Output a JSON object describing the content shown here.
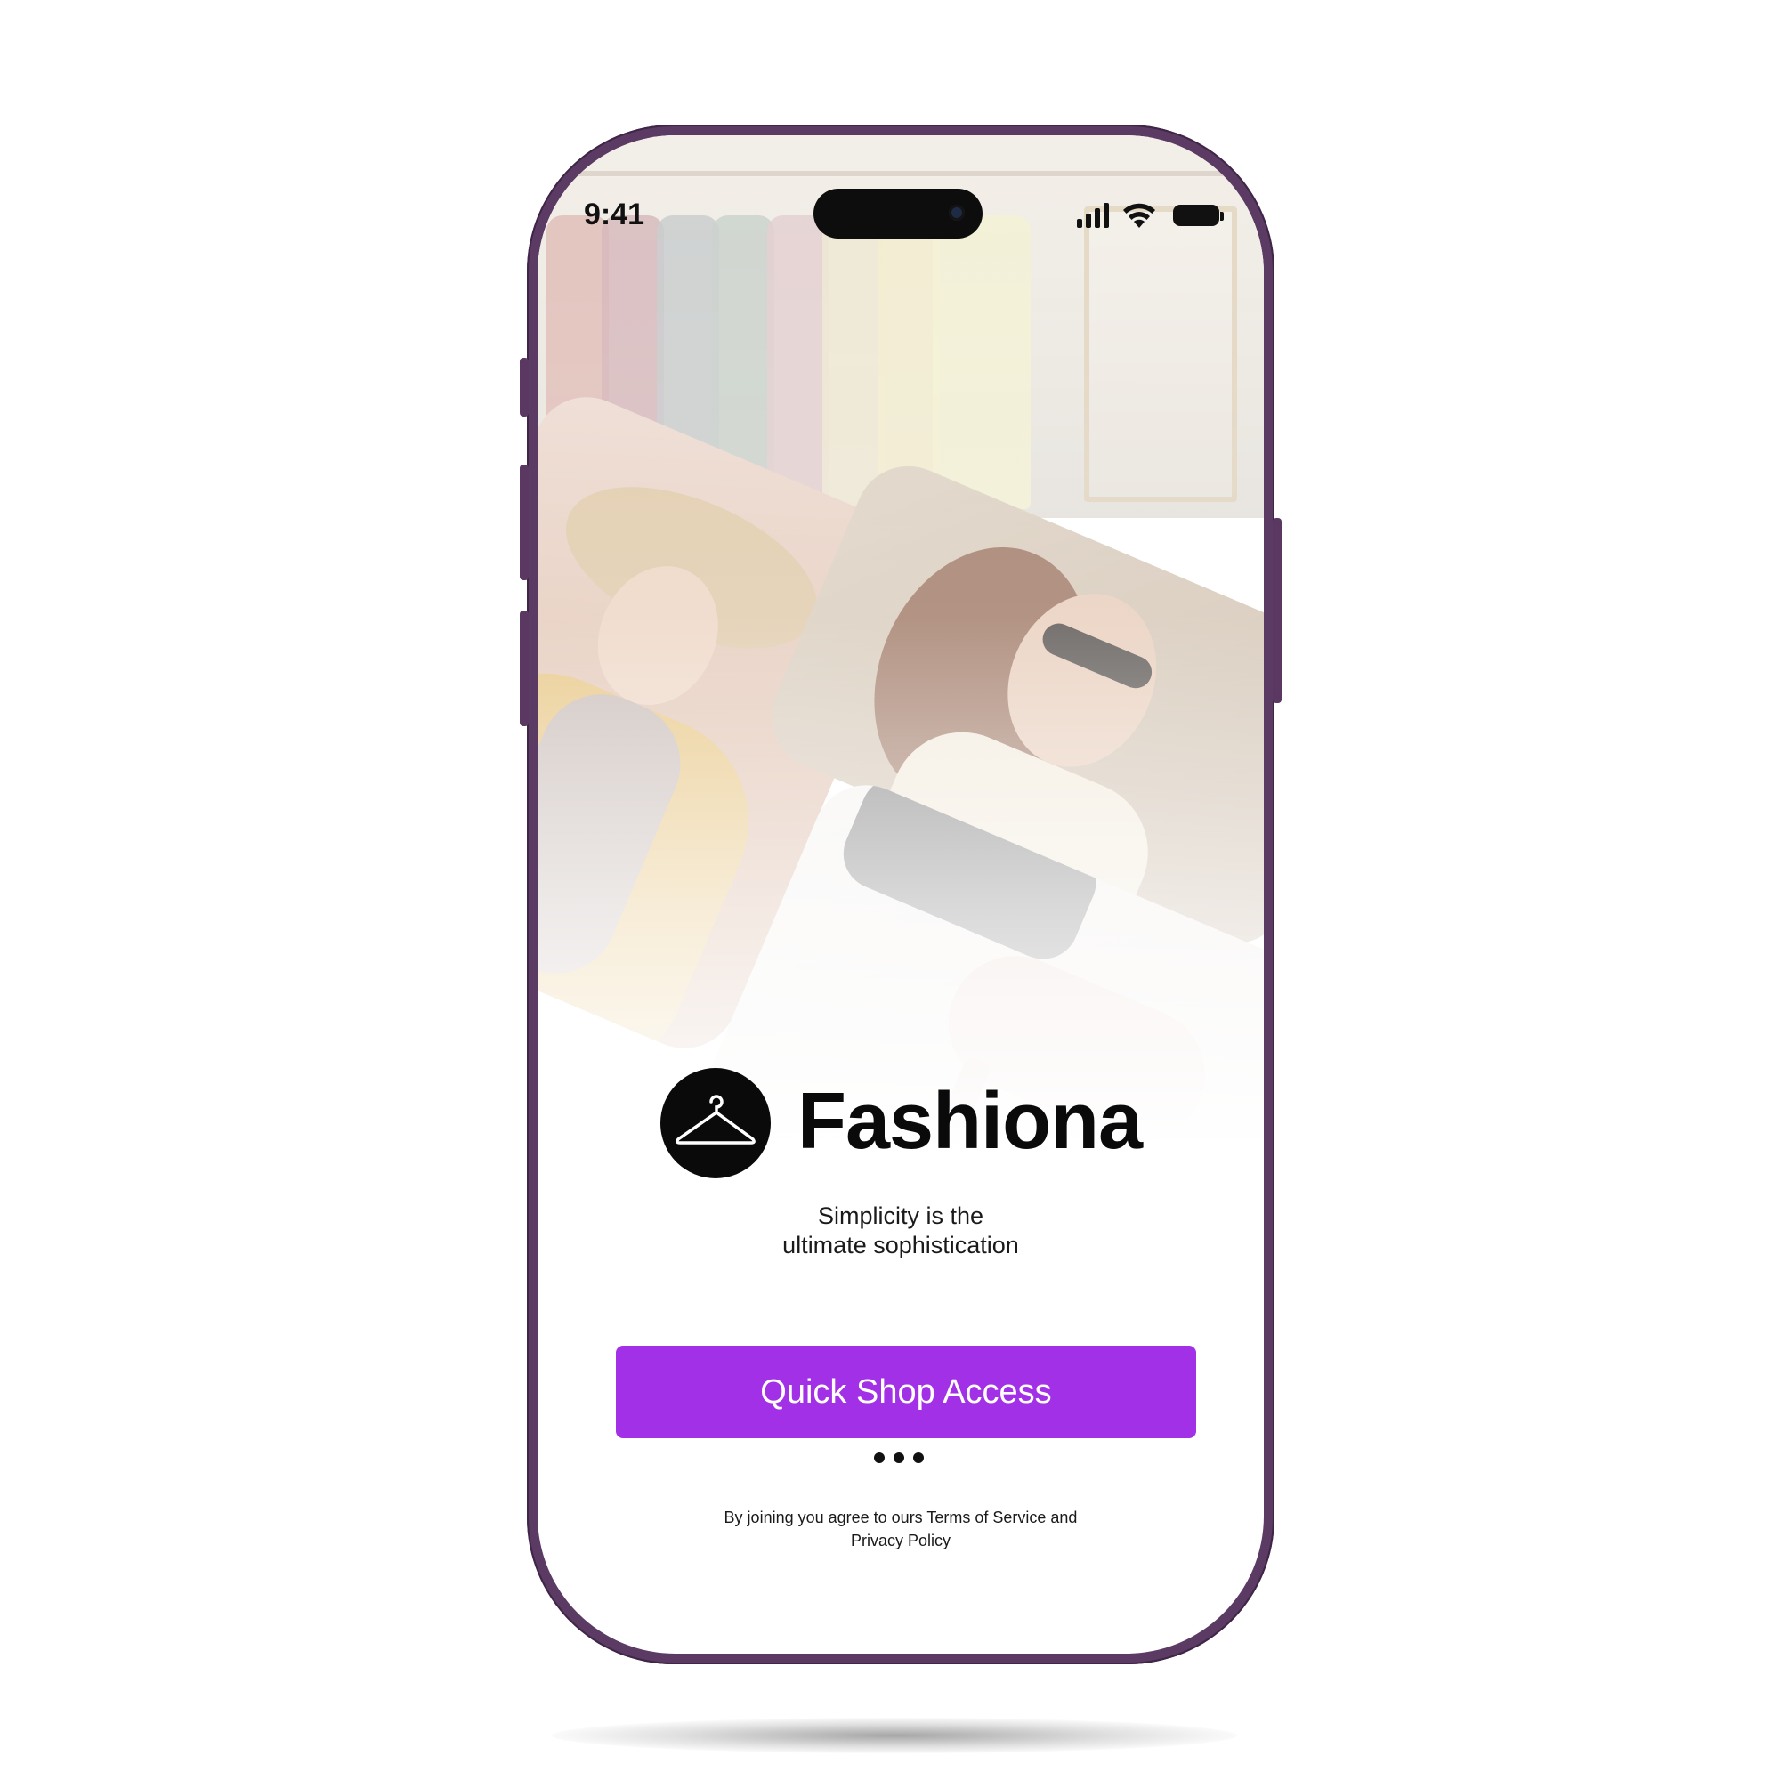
{
  "status_bar": {
    "time": "9:41",
    "icons": [
      "cellular-signal-icon",
      "wifi-icon",
      "battery-icon"
    ]
  },
  "hero": {
    "images": [
      "clothing-rack-photo",
      "woman-in-hat-photo",
      "woman-in-sunglasses-photo",
      "heel-shoe-photo"
    ]
  },
  "brand": {
    "name": "Fashiona",
    "logo_icon": "hanger-icon"
  },
  "tagline": {
    "line1": "Simplicity is the",
    "line2": "ultimate sophistication"
  },
  "cta": {
    "label": "Quick Shop Access"
  },
  "pager": {
    "dots": 3
  },
  "legal": {
    "prefix": "By joining you agree to ours ",
    "terms_link": "Terms of Service",
    "joiner": " and",
    "privacy_link": "Privacy Policy"
  },
  "colors": {
    "accent": "#a230e6",
    "frame": "#5b3a63",
    "text": "#0a0a0a"
  }
}
